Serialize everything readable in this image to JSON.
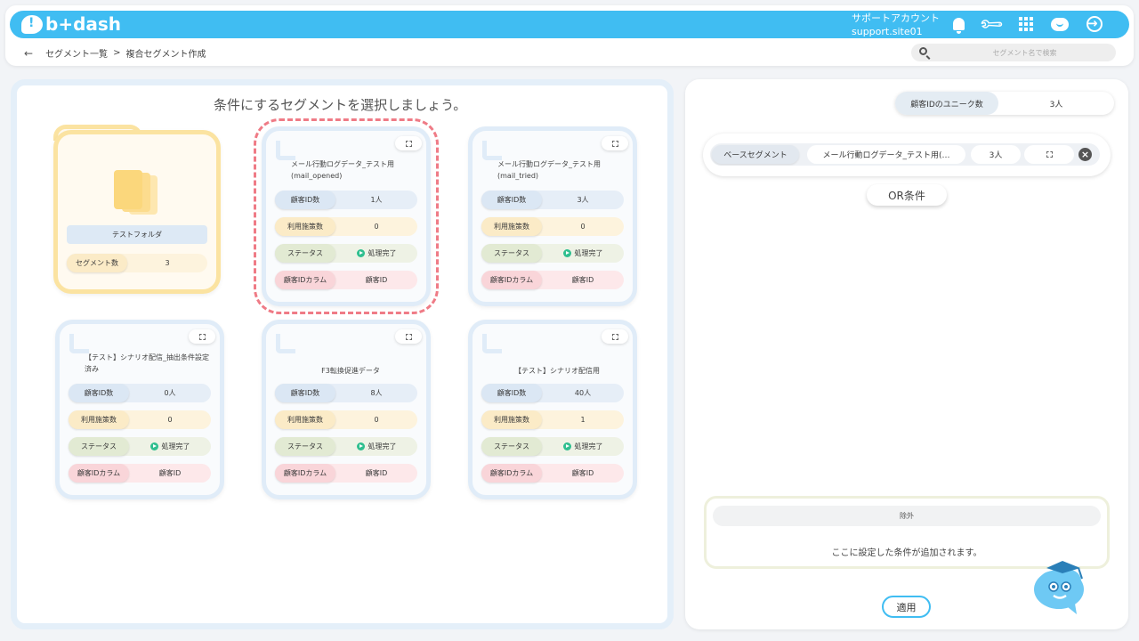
{
  "header": {
    "logo": "b+dash",
    "account_line1": "サポートアカウント",
    "account_line2": "support.site01",
    "icons": [
      "bell-icon",
      "wrench-icon",
      "apps-grid-icon",
      "cloud-face-icon",
      "logout-icon"
    ],
    "brand_color": "#40bdf2"
  },
  "breadcrumb": {
    "back": "←",
    "parent": "セグメント一覧",
    "separator": ">",
    "current": "複合セグメント作成"
  },
  "search": {
    "placeholder": "セグメント名で検索"
  },
  "left_panel": {
    "title": "条件にするセグメントを選択しましょう。",
    "folder": {
      "name": "テストフォルダ",
      "count_label": "セグメント数",
      "count_value": "3"
    },
    "labels": {
      "customer_id_count": "顧客ID数",
      "used_measures": "利用施策数",
      "status": "ステータス",
      "id_column": "顧客IDカラム"
    },
    "segments": [
      {
        "title": "メール行動ログデータ_テスト用(mail_opened)",
        "customer_ids": "1人",
        "measures": "0",
        "status": "処理完了",
        "id_column": "顧客ID",
        "selected": true
      },
      {
        "title": "メール行動ログデータ_テスト用(mail_tried)",
        "customer_ids": "3人",
        "measures": "0",
        "status": "処理完了",
        "id_column": "顧客ID",
        "selected": false
      },
      {
        "title": "【テスト】シナリオ配信_抽出条件設定済み",
        "customer_ids": "0人",
        "measures": "0",
        "status": "処理完了",
        "id_column": "顧客ID",
        "selected": false
      },
      {
        "title": "F3転換促進データ",
        "customer_ids": "8人",
        "measures": "0",
        "status": "処理完了",
        "id_column": "顧客ID",
        "selected": false
      },
      {
        "title": "【テスト】シナリオ配信用",
        "customer_ids": "40人",
        "measures": "1",
        "status": "処理完了",
        "id_column": "顧客ID",
        "selected": false
      }
    ]
  },
  "right_panel": {
    "unique_label": "顧客IDのユニーク数",
    "unique_value": "3人",
    "base_label": "ベースセグメント",
    "base_name": "メール行動ログデータ_テスト用(…",
    "base_count": "3人",
    "or_button": "OR条件",
    "exclude_label": "除外",
    "exclude_message": "ここに設定した条件が追加されます。",
    "apply_button": "適用"
  }
}
